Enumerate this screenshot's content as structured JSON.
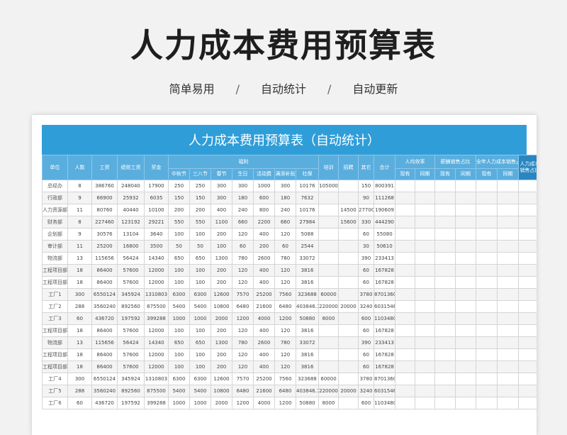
{
  "hero": {
    "title": "人力成本费用预算表",
    "tags": [
      "简单易用",
      "自动统计",
      "自动更新"
    ],
    "separator": "/"
  },
  "sheet": {
    "banner": "人力成本费用预算表（自动统计）",
    "headers": {
      "unit": "单位",
      "people": "人数",
      "wage": "工资",
      "perf": "绩效工资",
      "bonus": "奖金",
      "welfare": "福利",
      "welfare_sub": [
        "中秋节",
        "三八节",
        "春节",
        "生日",
        "活动费",
        "满添补贴",
        "社保"
      ],
      "training": "培训",
      "recruit": "招聘",
      "other": "其它",
      "total": "合计",
      "per_capita": "人均效率",
      "salary_ratio": "薪酬销售占比",
      "annual_ratio": "全年人力成本销售占比",
      "hr_ratio": "人力成本销售占比",
      "pair": [
        "现有",
        "同期"
      ]
    },
    "rows": [
      [
        "总经办",
        "8",
        "386760",
        "248040",
        "17900",
        "250",
        "250",
        "300",
        "300",
        "1000",
        "300",
        "10176",
        "105000",
        "",
        "150",
        "800391"
      ],
      [
        "行政部",
        "9",
        "66900",
        "25932",
        "6035",
        "150",
        "150",
        "300",
        "180",
        "600",
        "180",
        "7632",
        "",
        "",
        "90",
        "111268"
      ],
      [
        "人力资源部",
        "11",
        "80760",
        "40440",
        "10100",
        "200",
        "200",
        "400",
        "240",
        "800",
        "240",
        "10176",
        "",
        "14500",
        "27700",
        "190609"
      ],
      [
        "财务部",
        "8",
        "227460",
        "123192",
        "29221",
        "550",
        "550",
        "1100",
        "660",
        "2200",
        "660",
        "27984",
        "",
        "15600",
        "330",
        "444290"
      ],
      [
        "企划部",
        "9",
        "30576",
        "13104",
        "3640",
        "100",
        "100",
        "200",
        "120",
        "400",
        "120",
        "5088",
        "",
        "",
        "60",
        "55080"
      ],
      [
        "审计部",
        "11",
        "25200",
        "16800",
        "3500",
        "50",
        "50",
        "100",
        "60",
        "200",
        "60",
        "2544",
        "",
        "",
        "30",
        "50610"
      ],
      [
        "物流部",
        "13",
        "115656",
        "56424",
        "14340",
        "650",
        "650",
        "1300",
        "780",
        "2600",
        "780",
        "33072",
        "",
        "",
        "390",
        "233413"
      ],
      [
        "工程项目部",
        "18",
        "86400",
        "57600",
        "12000",
        "100",
        "100",
        "200",
        "120",
        "400",
        "120",
        "3816",
        "",
        "",
        "60",
        "167828"
      ],
      [
        "工程项目部",
        "18",
        "86400",
        "57600",
        "12000",
        "100",
        "100",
        "200",
        "120",
        "400",
        "120",
        "3816",
        "",
        "",
        "60",
        "167828"
      ],
      [
        "工厂1",
        "300",
        "6550124",
        "345924",
        "1310803",
        "6300",
        "6300",
        "12600",
        "7570",
        "25200",
        "7560",
        "323688",
        "60000",
        "",
        "3780",
        "8701360"
      ],
      [
        "工厂2",
        "288",
        "3560240",
        "892560",
        "875500",
        "5400",
        "5400",
        "10800",
        "6480",
        "21600",
        "6480",
        "403846.1",
        "220000",
        "20000",
        "3240",
        "6031546"
      ],
      [
        "工厂3",
        "60",
        "436720",
        "197592",
        "399288",
        "1000",
        "1000",
        "2000",
        "1200",
        "4000",
        "1200",
        "50880",
        "8000",
        "",
        "600",
        "1103480"
      ],
      [
        "工程项目部",
        "18",
        "86400",
        "57600",
        "12000",
        "100",
        "100",
        "200",
        "120",
        "400",
        "120",
        "3816",
        "",
        "",
        "60",
        "167828"
      ],
      [
        "物流部",
        "13",
        "115656",
        "56424",
        "14340",
        "650",
        "650",
        "1300",
        "780",
        "2600",
        "780",
        "33072",
        "",
        "",
        "390",
        "233413"
      ],
      [
        "工程项目部",
        "18",
        "86400",
        "57600",
        "12000",
        "100",
        "100",
        "200",
        "120",
        "400",
        "120",
        "3816",
        "",
        "",
        "60",
        "167828"
      ],
      [
        "工程项目部",
        "18",
        "86400",
        "57600",
        "12000",
        "100",
        "100",
        "200",
        "120",
        "400",
        "120",
        "3816",
        "",
        "",
        "60",
        "167828"
      ],
      [
        "工厂4",
        "300",
        "6550124",
        "345924",
        "1310803",
        "6300",
        "6300",
        "12600",
        "7570",
        "25200",
        "7560",
        "323688",
        "60000",
        "",
        "3780",
        "8701360"
      ],
      [
        "工厂5",
        "288",
        "3560240",
        "892560",
        "875500",
        "5400",
        "5400",
        "10800",
        "6480",
        "21600",
        "6480",
        "403846.1",
        "220000",
        "20000",
        "3240",
        "6031546"
      ],
      [
        "工厂6",
        "60",
        "436720",
        "197592",
        "399288",
        "1000",
        "1000",
        "2000",
        "1200",
        "4000",
        "1200",
        "50880",
        "8000",
        "",
        "600",
        "1103480"
      ]
    ]
  }
}
